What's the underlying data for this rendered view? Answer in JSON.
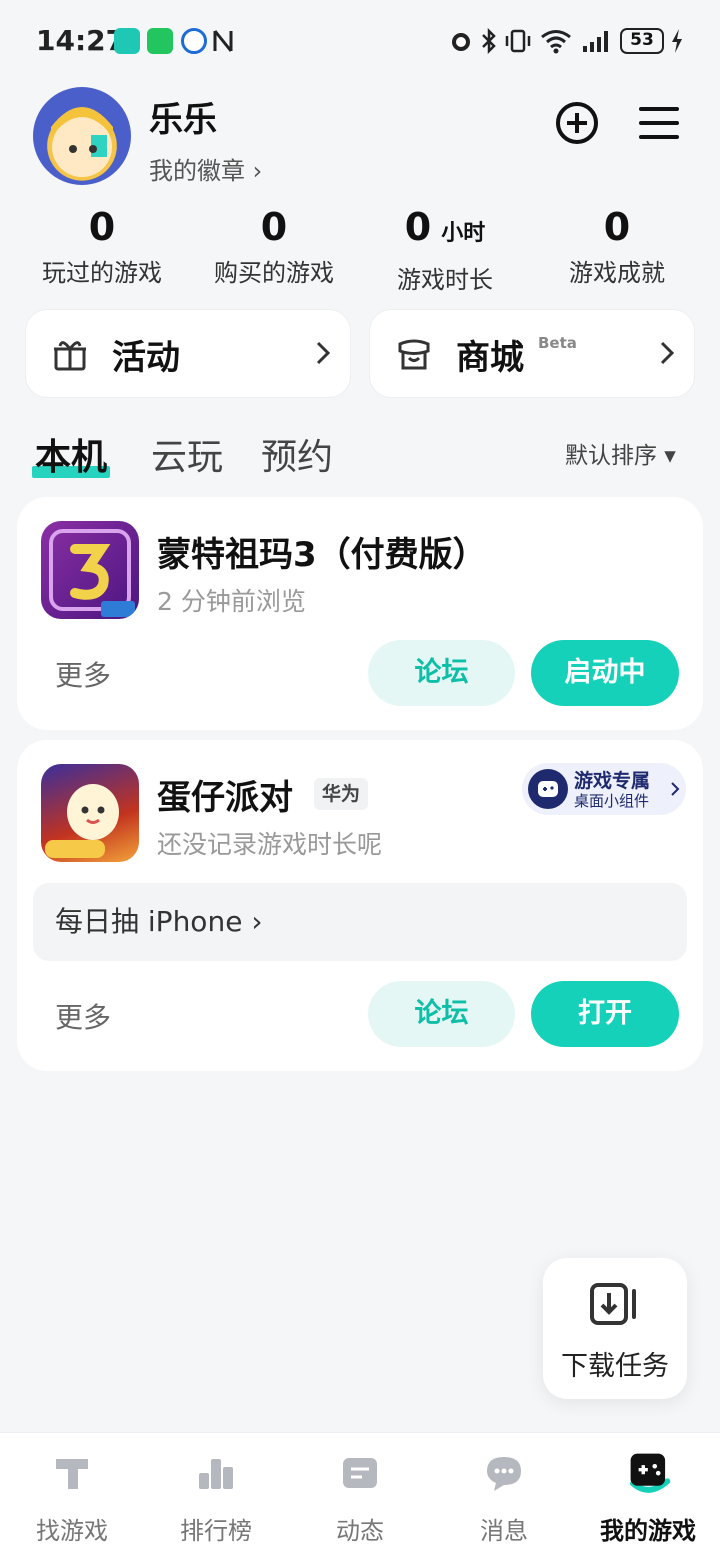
{
  "status_bar": {
    "time": "14:27",
    "battery": "53"
  },
  "profile": {
    "name": "乐乐",
    "badges_link": "我的徽章 ›"
  },
  "stats": [
    {
      "value": "0",
      "unit": "",
      "label": "玩过的游戏"
    },
    {
      "value": "0",
      "unit": "",
      "label": "购买的游戏"
    },
    {
      "value": "0",
      "unit": "小时",
      "label": "游戏时长"
    },
    {
      "value": "0",
      "unit": "",
      "label": "游戏成就"
    }
  ],
  "features": {
    "activity": {
      "label": "活动"
    },
    "mall": {
      "label": "商城",
      "beta": "Beta"
    }
  },
  "tabs": [
    "本机",
    "云玩",
    "预约"
  ],
  "sort": "默认排序 ▾",
  "games": [
    {
      "name": "蒙特祖玛3（付费版）",
      "subtitle": "2 分钟前浏览",
      "more": "更多",
      "forum": "论坛",
      "action": "启动中"
    },
    {
      "name": "蛋仔派对",
      "tag": "华为",
      "subtitle": "还没记录游戏时长呢",
      "widget_title": "游戏专属",
      "widget_sub": "桌面小组件",
      "promo": "每日抽 iPhone ›",
      "more": "更多",
      "forum": "论坛",
      "action": "打开"
    }
  ],
  "download_task": "下载任务",
  "nav": [
    {
      "label": "找游戏",
      "icon": "find-games-icon"
    },
    {
      "label": "排行榜",
      "icon": "ranking-icon"
    },
    {
      "label": "动态",
      "icon": "feed-icon"
    },
    {
      "label": "消息",
      "icon": "message-icon"
    },
    {
      "label": "我的游戏",
      "icon": "my-games-icon"
    }
  ],
  "colors": {
    "accent": "#16d1b9",
    "accent_light": "#e5f7f5"
  }
}
